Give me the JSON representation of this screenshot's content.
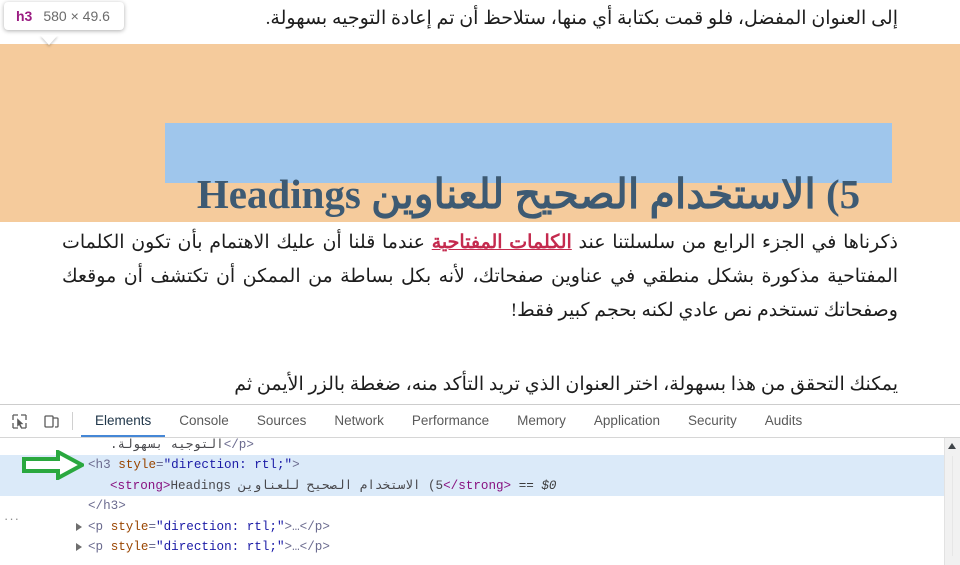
{
  "inspect_tooltip": {
    "tag": "h3",
    "dimensions": "580 × 49.6"
  },
  "page": {
    "paragraph_top": "إلى العنوان المفضل، فلو قمت بكتابة أي منها، ستلاحظ أن تم إعادة التوجيه بسهولة.",
    "heading": "5) الاستخدام الصحيح للعناوين Headings",
    "paragraph_body_before_link": "ذكرناها في الجزء الرابع من سلسلتنا عند ",
    "paragraph_link": "الكلمات المفتاحية",
    "paragraph_body_after_link": " عندما قلنا أن عليك الاهتمام بأن تكون الكلمات المفتاحية مذكورة بشكل منطقي في عناوين صفحاتك، لأنه بكل بساطة من الممكن أن تكتشف أن موقعك وصفحاتك تستخدم نص عادي لكنه بحجم كبير فقط!",
    "paragraph_last": "يمكنك التحقق من هذا بسهولة، اختر العنوان الذي تريد التأكد منه، ضغطة بالزر الأيمن ثم"
  },
  "devtools": {
    "icons": {
      "inspect": "inspect-element-icon",
      "device": "device-toolbar-icon"
    },
    "tabs": [
      {
        "label": "Elements",
        "active": true
      },
      {
        "label": "Console",
        "active": false
      },
      {
        "label": "Sources",
        "active": false
      },
      {
        "label": "Network",
        "active": false
      },
      {
        "label": "Performance",
        "active": false
      },
      {
        "label": "Memory",
        "active": false
      },
      {
        "label": "Application",
        "active": false
      },
      {
        "label": "Security",
        "active": false
      },
      {
        "label": "Audits",
        "active": false
      }
    ],
    "dom_lines": {
      "line1_arabic": "التوجيه بسهولة.",
      "line1_close": "</p>",
      "line2_open": "<h3 ",
      "line2_attr": "style",
      "line2_eq": "=",
      "line2_value": "\"direction: rtl;\"",
      "line2_gt": ">",
      "line3_strong_open": "<strong>",
      "line3_text": "5) الاستخدام الصحيح للعناوين Headings",
      "line3_strong_close": "</strong>",
      "line3_ref": "== $0",
      "line4_close": "</h3>",
      "line5_open": "<p ",
      "line5_attr": "style",
      "line5_eq": "=",
      "line5_value": "\"direction: rtl;\"",
      "line5_gt_ellipsis": ">…",
      "line5_close": "</p>",
      "line6_open": "<p ",
      "line6_attr": "style",
      "line6_eq": "=",
      "line6_value": "\"direction: rtl;\"",
      "line6_gt_ellipsis": ">…",
      "line6_close": "</p>",
      "gutter_ellipsis": "···"
    }
  },
  "annotation": {
    "arrow": "green-arrow-pointing-right"
  },
  "colors": {
    "margin_highlight": "#f5cb9c",
    "content_highlight": "#9fc6ec",
    "heading_text": "#3d5a73",
    "link": "#c42a4e",
    "selected_row": "#dbeaf9",
    "tab_active_underline": "#4587d6",
    "tooltip_tag": "#9b1c82",
    "annotation_arrow": "#2aa83f"
  }
}
